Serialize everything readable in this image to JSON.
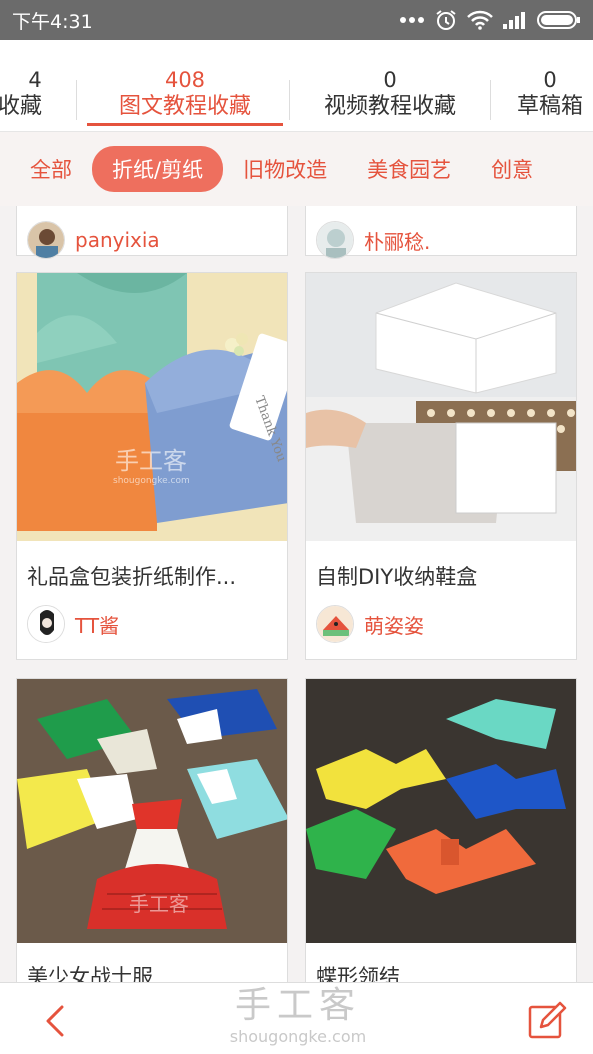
{
  "status": {
    "time": "下午4:31"
  },
  "header": {
    "tabs": [
      {
        "count": "4",
        "label": "圈收藏"
      },
      {
        "count": "408",
        "label": "图文教程收藏"
      },
      {
        "count": "0",
        "label": "视频教程收藏"
      },
      {
        "count": "0",
        "label": "草稿箱"
      }
    ]
  },
  "categories": [
    "全部",
    "折纸/剪纸",
    "旧物改造",
    "美食园艺",
    "创意"
  ],
  "cards": [
    {
      "title": "",
      "author": "panyixia"
    },
    {
      "title": "",
      "author": "朴郦稔."
    },
    {
      "title": "礼品盒包装折纸制作...",
      "author": "TT酱"
    },
    {
      "title": "自制DIY收纳鞋盒",
      "author": "萌姿姿"
    },
    {
      "title": "美少女战士服",
      "author": ""
    },
    {
      "title": "蝶形领结",
      "author": ""
    }
  ],
  "image_watermark": {
    "cn": "手工客",
    "en": "shougongke.com"
  },
  "bottom": {
    "brand_cn": "手工客",
    "brand_en": "shougongke.com"
  },
  "colors": {
    "accent": "#e5533d",
    "pill": "#ee6f5e",
    "statusbar": "#6b6b6b"
  },
  "icons": {
    "back": "chevron-left-icon",
    "edit": "edit-icon"
  }
}
